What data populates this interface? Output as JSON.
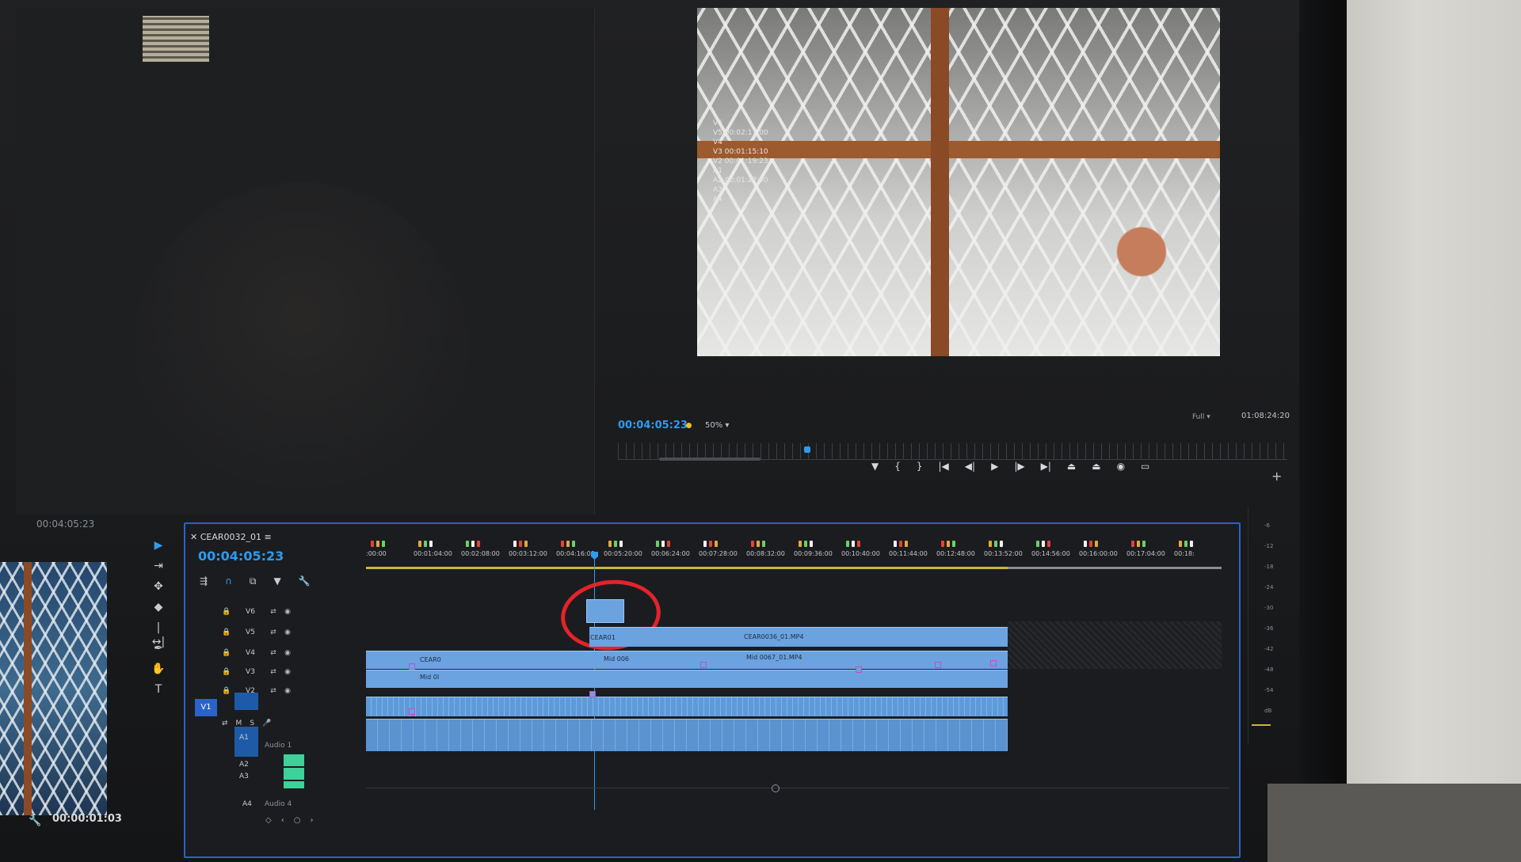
{
  "source_monitor": {
    "timecode": "00:04:05:23"
  },
  "program_monitor": {
    "overlay_lines": [
      "V6",
      "V5 00:02:17:00",
      "V4",
      "V3 00:01:15:10",
      "V2 00:01:19:23",
      "A1",
      "A2 00:01:27:00",
      "A3",
      "A4"
    ],
    "timecode": "00:04:05:23",
    "zoom": "50%",
    "quality": "Full",
    "duration": "01:08:24:20",
    "controls": [
      "marker-icon",
      "in-icon",
      "out-icon",
      "go-to-in-icon",
      "step-back-icon",
      "play-icon",
      "step-forward-icon",
      "go-to-out-icon",
      "lift-icon",
      "extract-icon",
      "export-frame-icon",
      "safe-margins-icon"
    ],
    "control_glyphs": [
      "▼",
      "{",
      "}",
      "|◀",
      "◀|",
      "▶",
      "|▶",
      "▶|",
      "⏏",
      "⏏",
      "◉",
      "▭"
    ],
    "add_button": "+"
  },
  "thumbnail": {
    "timecode": "00:00:01:03"
  },
  "sequence": {
    "tab_label": "CEAR0032_01",
    "tab_menu": "≡",
    "timecode": "00:04:05:23",
    "icon_glyphs": [
      "⇶",
      "∩",
      "⧉",
      "▼",
      "🔧"
    ],
    "ruler_labels": [
      ":00:00",
      "00:01:04:00",
      "00:02:08:00",
      "00:03:12:00",
      "00:04:16:00",
      "00:05:20:00",
      "00:06:24:00",
      "00:07:28:00",
      "00:08:32:00",
      "00:09:36:00",
      "00:10:40:00",
      "00:11:44:00",
      "00:12:48:00",
      "00:13:52:00",
      "00:14:56:00",
      "00:16:00:00",
      "00:17:04:00",
      "00:18:"
    ],
    "video_tracks": [
      "V6",
      "V5",
      "V4",
      "V3",
      "V2"
    ],
    "source_patch": "V1",
    "audio_tracks": [
      {
        "id": "A1",
        "name": "Audio 1"
      },
      {
        "id": "A2",
        "name": ""
      },
      {
        "id": "A3",
        "name": ""
      },
      {
        "id": "A4",
        "name": "Audio 4"
      }
    ],
    "track_buttons": {
      "sync": "⇄",
      "eye": "◉",
      "mute": "M",
      "solo": "S",
      "mic": "🎤",
      "lock": "🔒"
    },
    "clip_labels": [
      "CEAR0",
      "CEAR01",
      "CEAR0036_01.MP4",
      "Mid 0I",
      "Mid 006",
      "Mid 0067_01.MP4"
    ],
    "bottom_icons": [
      "◇",
      "‹",
      "○",
      "›"
    ]
  },
  "tools": [
    "selection-tool-icon",
    "track-select-icon",
    "ripple-edit-icon",
    "razor-icon",
    "slip-icon",
    "pen-icon",
    "hand-icon",
    "type-icon"
  ],
  "tool_glyphs": [
    "▶",
    "⇥",
    "✥",
    "◆",
    "|↔|",
    "✒",
    "✋",
    "T"
  ],
  "meter_labels": [
    "-6",
    "-12",
    "-18",
    "-24",
    "-30",
    "-36",
    "-42",
    "-48",
    "-54",
    "dB"
  ],
  "colors": {
    "accent": "#2d9bf0",
    "clip": "#6ba3e0",
    "annotation": "#e3232a",
    "workarea": "#c8b641"
  }
}
